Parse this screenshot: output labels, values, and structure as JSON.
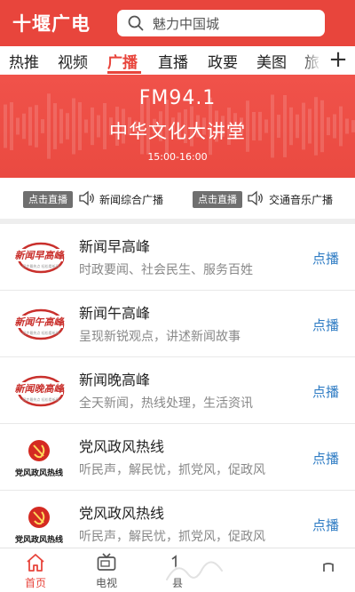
{
  "header": {
    "app_title": "十堰广电",
    "search_placeholder": "魅力中国城"
  },
  "tabs": [
    {
      "label": "热推",
      "active": false
    },
    {
      "label": "视频",
      "active": false
    },
    {
      "label": "广播",
      "active": true
    },
    {
      "label": "直播",
      "active": false
    },
    {
      "label": "政要",
      "active": false
    },
    {
      "label": "美图",
      "active": false
    },
    {
      "label": "旅",
      "active": false
    }
  ],
  "add_tab_label": "+",
  "banner": {
    "frequency": "FM94.1",
    "program": "中华文化大讲堂",
    "time": "15:00-16:00"
  },
  "live": [
    {
      "button": "点击直播",
      "channel": "新闻综合广播"
    },
    {
      "button": "点击直播",
      "channel": "交通音乐广播"
    }
  ],
  "programs": [
    {
      "title": "新闻早高峰",
      "subtitle": "时政要闻、社会民生、服务百姓",
      "action": "点播",
      "logo": "新闻早高峰",
      "logo_sub": "同步最热点 轻松看新闻",
      "icon": "news-logo"
    },
    {
      "title": "新闻午高峰",
      "subtitle": "呈现新锐观点，讲述新闻故事",
      "action": "点播",
      "logo": "新闻午高峰",
      "logo_sub": "同步最热点 轻松看新闻",
      "icon": "news-logo"
    },
    {
      "title": "新闻晚高峰",
      "subtitle": "全天新闻，热线处理，生活资讯",
      "action": "点播",
      "logo": "新闻晚高峰",
      "logo_sub": "同步最热点 轻松看新闻",
      "icon": "news-logo"
    },
    {
      "title": "党风政风热线",
      "subtitle": "听民声，解民忧，抓党风，促政风",
      "action": "点播",
      "logo": "党风政风热线",
      "icon": "party-emblem"
    },
    {
      "title": "党风政风热线",
      "subtitle": "听民声，解民忧，抓党风，促政风",
      "action": "点播",
      "logo": "党风政风热线",
      "icon": "party-emblem"
    }
  ],
  "bottom_nav": [
    {
      "label": "首页",
      "icon": "home-icon",
      "active": true
    },
    {
      "label": "电视",
      "icon": "tv-icon",
      "active": false
    },
    {
      "label": "县",
      "icon": "county-icon",
      "active": false
    },
    {
      "label": "",
      "icon": "user-icon",
      "active": false
    }
  ],
  "colors": {
    "brand_red": "#e8453c",
    "play_blue": "#2f7cc4",
    "muted_text": "#888888"
  }
}
